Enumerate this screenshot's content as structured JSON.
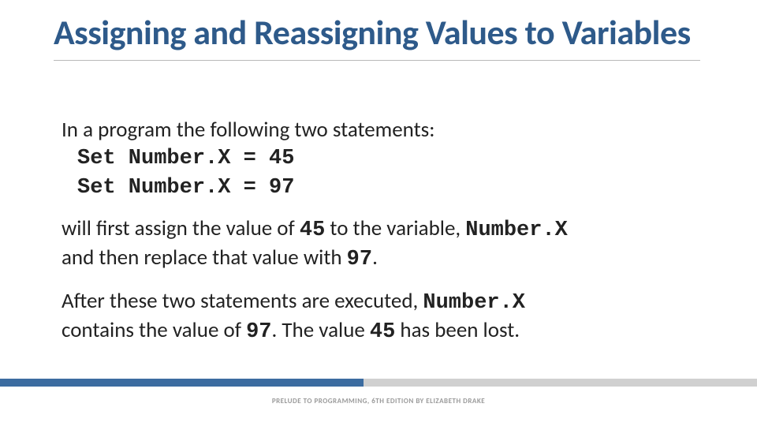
{
  "title": "Assigning and Reassigning Values to Variables",
  "body": {
    "intro": "In a program the following two statements:",
    "stmt1": "Set Number.X = 45",
    "stmt2": "Set Number.X = 97",
    "p2_a": "will first assign the value of ",
    "p2_b": "45",
    "p2_c": " to the variable, ",
    "p2_d": "Number.X",
    "p2_e": " and then replace that value with ",
    "p2_f": "97",
    "p2_g": ".",
    "p3_a": "After these two statements are executed, ",
    "p3_b": "Number.X",
    "p3_c": " contains the value of ",
    "p3_d": "97",
    "p3_e": ". The value ",
    "p3_f": "45",
    "p3_g": " has been lost."
  },
  "footer": "PRELUDE TO PROGRAMMING, 6TH EDITION BY ELIZABETH DRAKE"
}
